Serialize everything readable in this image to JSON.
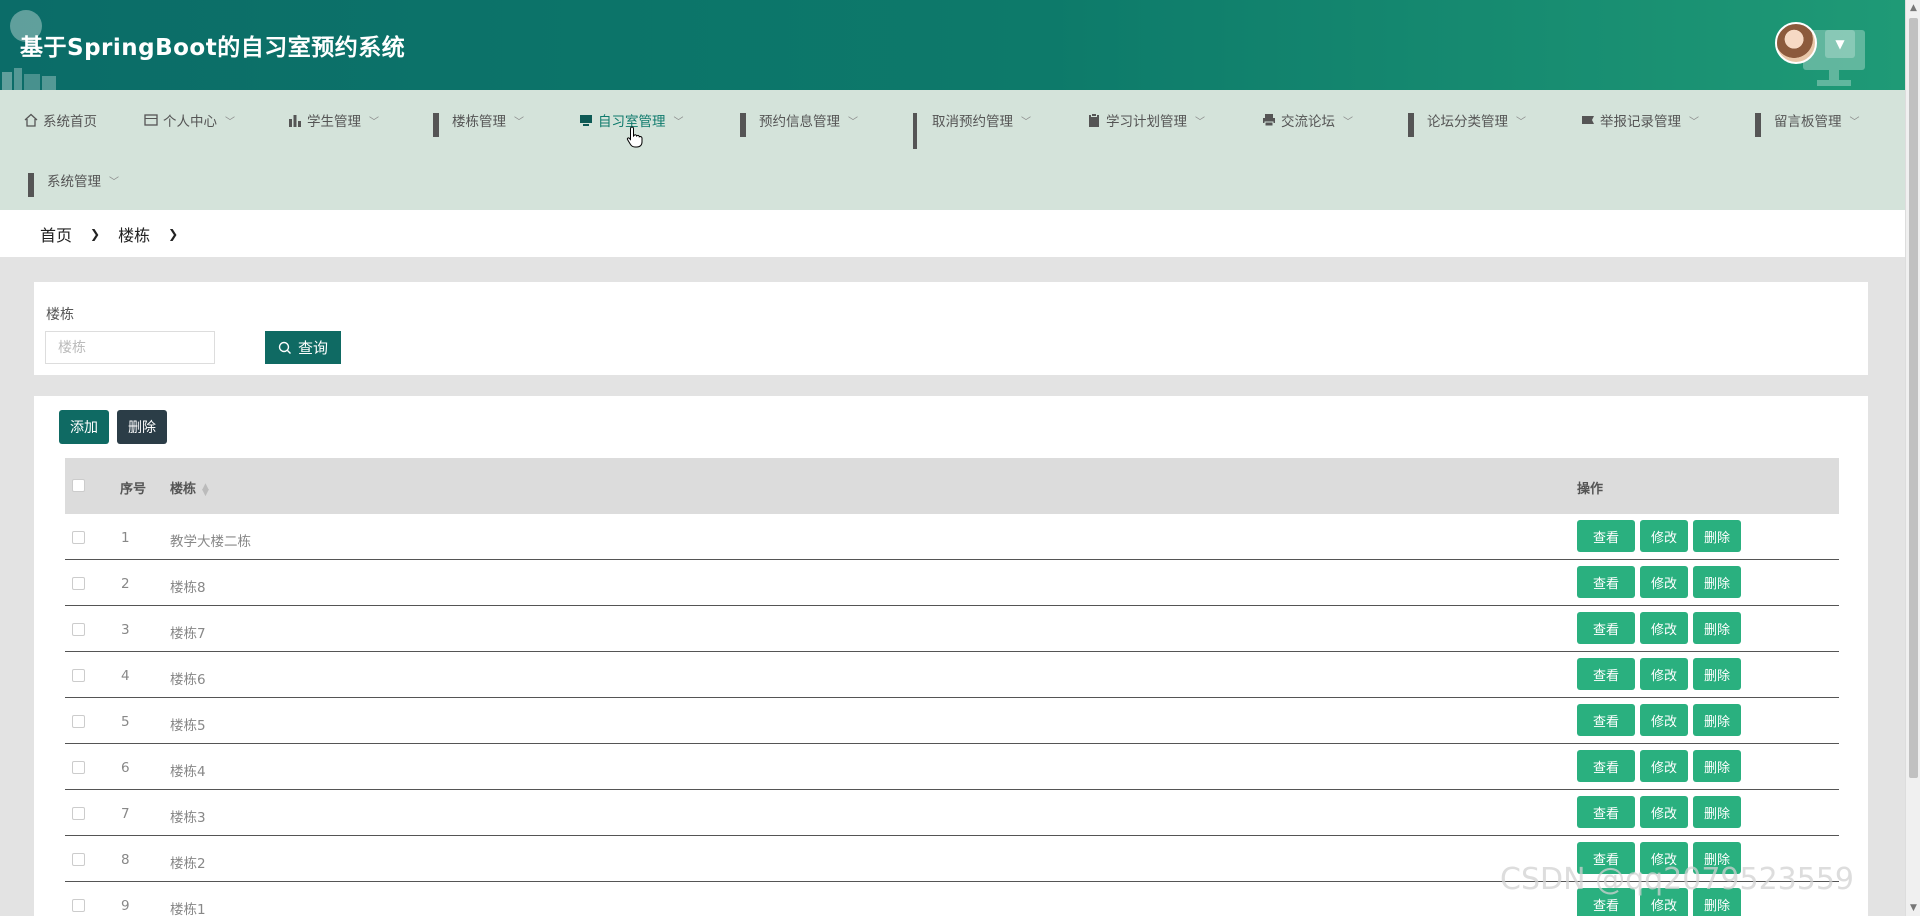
{
  "header": {
    "title": "基于SpringBoot的自习室预约系统",
    "avatar": "user-avatar",
    "colors": {
      "gradient_start": "#0b6c68",
      "gradient_end": "#1f9a76"
    }
  },
  "nav": {
    "items": [
      {
        "label": "系统首页",
        "icon": "home-icon"
      },
      {
        "label": "个人中心",
        "icon": "id-card-icon"
      },
      {
        "label": "学生管理",
        "icon": "bar-chart-icon"
      },
      {
        "label": "楼栋管理",
        "icon": "grid-icon"
      },
      {
        "label": "自习室管理",
        "icon": "monitor-icon"
      },
      {
        "label": "预约信息管理",
        "icon": "grid-icon"
      },
      {
        "label": "取消预约管理",
        "icon": "apps-icon"
      },
      {
        "label": "学习计划管理",
        "icon": "clipboard-icon"
      },
      {
        "label": "交流论坛",
        "icon": "printer-icon"
      },
      {
        "label": "论坛分类管理",
        "icon": "grid-icon"
      },
      {
        "label": "举报记录管理",
        "icon": "flag-icon"
      },
      {
        "label": "留言板管理",
        "icon": "grid-icon"
      },
      {
        "label": "系统管理",
        "icon": "grid-icon"
      }
    ]
  },
  "breadcrumb": {
    "home": "首页",
    "current": "楼栋"
  },
  "search": {
    "label": "楼栋",
    "placeholder": "楼栋",
    "value": "",
    "button": "查询"
  },
  "toolbar": {
    "add": "添加",
    "delete": "删除"
  },
  "table": {
    "headers": {
      "index": "序号",
      "building": "楼栋",
      "actions": "操作"
    },
    "rows": [
      {
        "index": "1",
        "building": "教学大楼二栋"
      },
      {
        "index": "2",
        "building": "楼栋8"
      },
      {
        "index": "3",
        "building": "楼栋7"
      },
      {
        "index": "4",
        "building": "楼栋6"
      },
      {
        "index": "5",
        "building": "楼栋5"
      },
      {
        "index": "6",
        "building": "楼栋4"
      },
      {
        "index": "7",
        "building": "楼栋3"
      },
      {
        "index": "8",
        "building": "楼栋2"
      },
      {
        "index": "9",
        "building": "楼栋1"
      }
    ],
    "actions": {
      "view": "查看",
      "edit": "修改",
      "delete": "删除"
    }
  },
  "watermark": "CSDN @qq2079523559",
  "colors": {
    "primary": "#0f6a63",
    "action": "#2ab07f",
    "nav_bg": "#d4e3da",
    "dark_button": "#2b3d47"
  }
}
